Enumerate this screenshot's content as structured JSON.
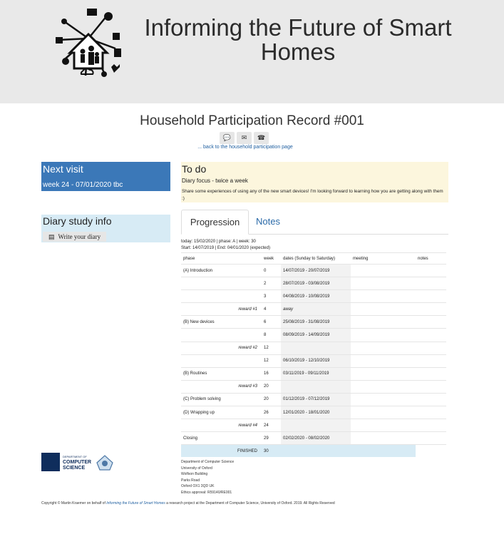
{
  "header": {
    "title": "Informing the Future of Smart Homes"
  },
  "record": {
    "title": "Household Participation Record #001",
    "icons": [
      "chat-icon",
      "email-icon",
      "phone-icon"
    ],
    "back_link": "... back to the household participation page"
  },
  "next_visit": {
    "heading": "Next visit",
    "value": "week 24 - 07/01/2020 tbc"
  },
  "diary": {
    "heading": "Diary study info",
    "button_label": "Write your diary"
  },
  "todo": {
    "heading": "To do",
    "focus": "Diary focus - twice a week",
    "text": "Share some experiences of using any of the new smart devices! I'm looking forward to learning how you are getting along with them :)"
  },
  "tabs": {
    "progression": "Progression",
    "notes": "Notes"
  },
  "progression": {
    "today_line": "today: 15/02/2020 | phase: A | week: 30",
    "start_line": "Start: 14/07/2019 | End: 04/01/2020 (expected)",
    "columns": {
      "phase": "phase",
      "week": "week",
      "dates": "dates (Sunday to Saturday)",
      "meeting": "meeting",
      "notes": "notes"
    },
    "rows": [
      {
        "phase": "(A) Introduction",
        "week": "0",
        "dates": "14/07/2019 - 20/07/2019"
      },
      {
        "phase": "",
        "week": "2",
        "dates": "28/07/2019 - 03/08/2019"
      },
      {
        "phase": "",
        "week": "3",
        "dates": "04/08/2019 - 10/08/2019"
      },
      {
        "phase": "reward #1",
        "week": "4",
        "dates": "away"
      },
      {
        "phase": "(B) New devices",
        "week": "6",
        "dates": "25/08/2019 - 31/08/2019"
      },
      {
        "phase": "",
        "week": "8",
        "dates": "08/09/2019 - 14/09/2019"
      },
      {
        "phase": "reward #2",
        "week": "12",
        "dates": ""
      },
      {
        "phase": "",
        "week": "12",
        "dates": "06/10/2019 - 12/10/2019"
      },
      {
        "phase": "(B) Routines",
        "week": "16",
        "dates": "03/11/2019 - 09/11/2019"
      },
      {
        "phase": "reward #3",
        "week": "20",
        "dates": ""
      },
      {
        "phase": "(C) Problem solving",
        "week": "20",
        "dates": "01/12/2019 - 07/12/2019"
      },
      {
        "phase": "(D) Wrapping up",
        "week": "26",
        "dates": "12/01/2020 - 18/01/2020"
      },
      {
        "phase": "reward #4",
        "week": "24",
        "dates": ""
      },
      {
        "phase": "Closing",
        "week": "29",
        "dates": "02/02/2020 - 08/02/2020"
      },
      {
        "phase": "FINISHED",
        "week": "30",
        "dates": ""
      }
    ]
  },
  "footer": {
    "logo_text": "COMPUTER SCIENCE",
    "logo_small": "DEPARTMENT OF",
    "address": [
      "Department of Computer Science",
      "University of Oxford",
      "Wolfson Building",
      "Parks Road",
      "Oxford OX1 3QD UK",
      "Ethics approval: R59140/RE001"
    ],
    "copyright_pre": "Copyright © Martin Kraemer on behalf of ",
    "copyright_link": "Informing the Future of Smart Homes",
    "copyright_post": " a research project at the Department of Computer Science, University of Oxford. 2019. All Rights Reserved"
  }
}
